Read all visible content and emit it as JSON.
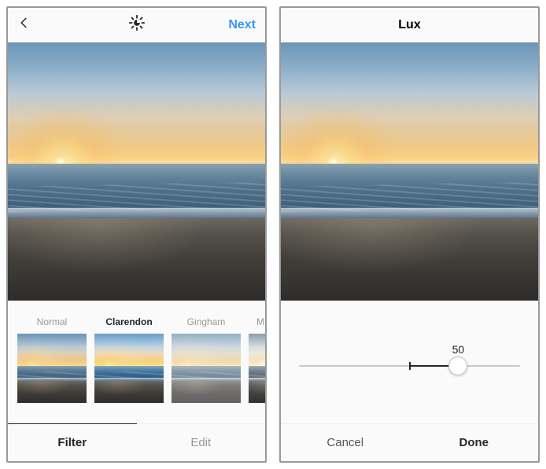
{
  "left": {
    "header": {
      "next_label": "Next"
    },
    "filters": {
      "items": [
        {
          "label": "Normal"
        },
        {
          "label": "Clarendon"
        },
        {
          "label": "Gingham"
        },
        {
          "label": "M"
        }
      ],
      "selected_index": 1
    },
    "tabs": {
      "filter_label": "Filter",
      "edit_label": "Edit",
      "active": "Filter"
    }
  },
  "right": {
    "header": {
      "title": "Lux"
    },
    "slider": {
      "value": "50"
    },
    "footer": {
      "cancel_label": "Cancel",
      "done_label": "Done"
    }
  },
  "icons": {
    "back": "back-chevron-icon",
    "sun": "lux-sun-icon"
  }
}
